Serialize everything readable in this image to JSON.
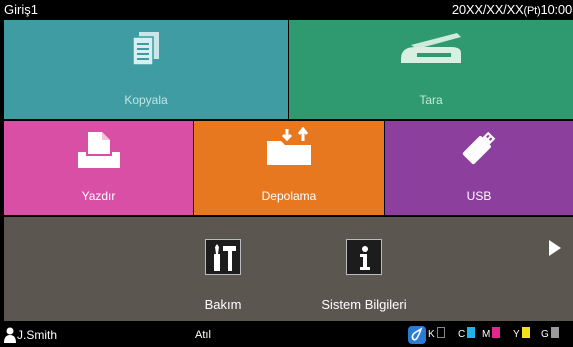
{
  "header": {
    "title": "Giriş1",
    "date": "20XX/XX/XX",
    "day": "(Pt)",
    "time": "10:00"
  },
  "tiles": {
    "copy": {
      "label": "Kopyala",
      "icon": "copy-icon",
      "color": "#3e9ca2"
    },
    "scan": {
      "label": "Tara",
      "icon": "scanner-icon",
      "color": "#2f9970"
    },
    "print": {
      "label": "Yazdır",
      "icon": "printer-icon",
      "color": "#d94fa6"
    },
    "storage": {
      "label": "Depolama",
      "icon": "folder-icon",
      "color": "#e8781f"
    },
    "usb": {
      "label": "USB",
      "icon": "usb-icon",
      "color": "#8c3f9c"
    }
  },
  "tools": {
    "maintenance": {
      "label": "Bakım",
      "icon": "tools-icon"
    },
    "system_info": {
      "label": "Sistem Bilgileri",
      "icon": "info-icon"
    }
  },
  "status": {
    "user": "J.Smith",
    "state": "Atıl",
    "inks": [
      {
        "letter": "K",
        "color": "#222222"
      },
      {
        "letter": "C",
        "color": "#1fb3e8"
      },
      {
        "letter": "M",
        "color": "#e0288f"
      },
      {
        "letter": "Y",
        "color": "#f2e01a"
      },
      {
        "letter": "G",
        "color": "#9a9a9a"
      }
    ]
  }
}
